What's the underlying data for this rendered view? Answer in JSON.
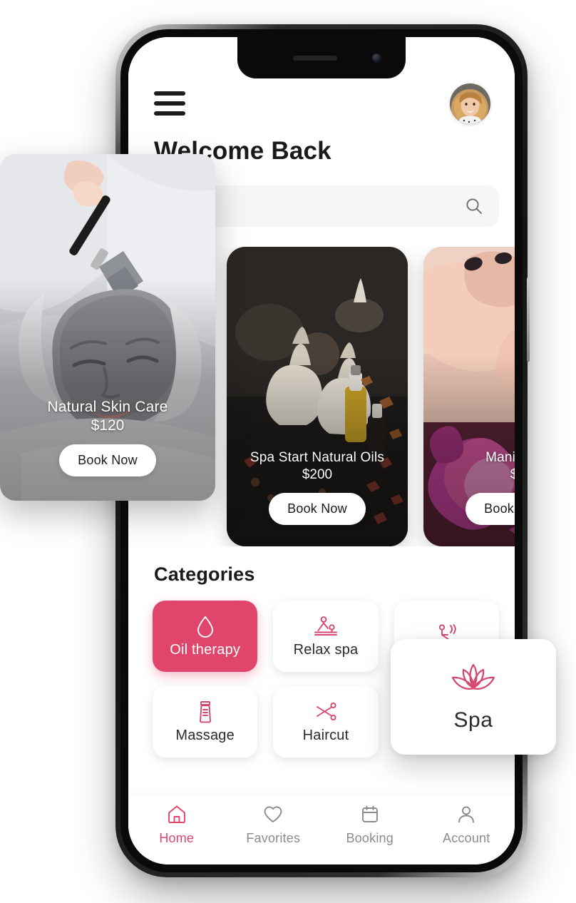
{
  "app": {
    "header": {
      "menu_icon": "hamburger-menu-icon",
      "avatar_icon": "user-avatar",
      "greeting": "Welcome Back"
    },
    "search": {
      "value": "",
      "placeholder": "",
      "icon": "search-icon"
    },
    "promos": [
      {
        "title": "Spa Start Natural Oils",
        "price": "$200",
        "cta": "Book Now",
        "image": "spa-herbal-compress-oils"
      },
      {
        "title": "Manicure",
        "price": "$",
        "cta": "Book Now",
        "image": "manicure-hands"
      }
    ],
    "categories": {
      "title": "Categories",
      "items": [
        {
          "label": "Oil therapy",
          "icon": "oil-drop-icon",
          "active": true
        },
        {
          "label": "Relax spa",
          "icon": "massage-table-icon",
          "active": false
        },
        {
          "label": "",
          "icon": "sauna-person-icon",
          "active": false
        },
        {
          "label": "Massage",
          "icon": "lotion-tube-icon",
          "active": false
        },
        {
          "label": "Haircut",
          "icon": "scissors-icon",
          "active": false
        }
      ]
    },
    "bottom_nav": [
      {
        "label": "Home",
        "icon": "home-icon",
        "active": true
      },
      {
        "label": "Favorites",
        "icon": "heart-icon",
        "active": false
      },
      {
        "label": "Booking",
        "icon": "calendar-icon",
        "active": false
      },
      {
        "label": "Account",
        "icon": "person-icon",
        "active": false
      }
    ]
  },
  "overlays": {
    "skin_card": {
      "title": "Natural Skin Care",
      "price": "$120",
      "cta": "Book Now",
      "image": "facial-clay-mask-treatment"
    },
    "spa_card": {
      "label": "Spa",
      "icon": "lotus-flower-icon"
    }
  },
  "colors": {
    "accent": "#E0466B",
    "text_primary": "#1a1a1a",
    "text_muted": "#8b8b8b",
    "search_bg": "#f6f6f6",
    "screen_bg": "#ffffff"
  }
}
